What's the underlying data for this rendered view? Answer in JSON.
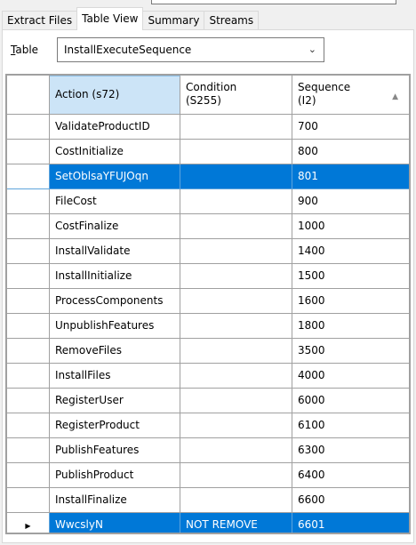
{
  "tabs": [
    {
      "label": "Extract Files",
      "active": false
    },
    {
      "label": "Table View",
      "active": true
    },
    {
      "label": "Summary",
      "active": false
    },
    {
      "label": "Streams",
      "active": false
    }
  ],
  "table_picker": {
    "label_accel": "T",
    "label_rest": "able",
    "selected": "InstallExecuteSequence"
  },
  "grid": {
    "columns": [
      "",
      "Action (s72)",
      "Condition\n(S255)",
      "Sequence\n(I2)"
    ],
    "rows": [
      {
        "action": "ValidateProductID",
        "condition": "",
        "sequence": "700"
      },
      {
        "action": "CostInitialize",
        "condition": "",
        "sequence": "800"
      },
      {
        "action": "SetOblsaYFUJOqn",
        "condition": "",
        "sequence": "801",
        "selected": true
      },
      {
        "action": "FileCost",
        "condition": "",
        "sequence": "900"
      },
      {
        "action": "CostFinalize",
        "condition": "",
        "sequence": "1000"
      },
      {
        "action": "InstallValidate",
        "condition": "",
        "sequence": "1400"
      },
      {
        "action": "InstallInitialize",
        "condition": "",
        "sequence": "1500"
      },
      {
        "action": "ProcessComponents",
        "condition": "",
        "sequence": "1600"
      },
      {
        "action": "UnpublishFeatures",
        "condition": "",
        "sequence": "1800"
      },
      {
        "action": "RemoveFiles",
        "condition": "",
        "sequence": "3500"
      },
      {
        "action": "InstallFiles",
        "condition": "",
        "sequence": "4000"
      },
      {
        "action": "RegisterUser",
        "condition": "",
        "sequence": "6000"
      },
      {
        "action": "RegisterProduct",
        "condition": "",
        "sequence": "6100"
      },
      {
        "action": "PublishFeatures",
        "condition": "",
        "sequence": "6300"
      },
      {
        "action": "PublishProduct",
        "condition": "",
        "sequence": "6400"
      },
      {
        "action": "InstallFinalize",
        "condition": "",
        "sequence": "6600"
      },
      {
        "action": "WwcslyN",
        "condition": "NOT REMOVE",
        "sequence": "6601",
        "selected": true,
        "current": true
      }
    ]
  },
  "colors": {
    "selection": "#0078d7",
    "header_highlight": "#cce4f7",
    "grid_line": "#a0a0a0"
  },
  "icons": {
    "select_chevron": "chevron-down-icon",
    "sort": "sort-ascending-icon",
    "row_pointer": "current-row-icon"
  }
}
